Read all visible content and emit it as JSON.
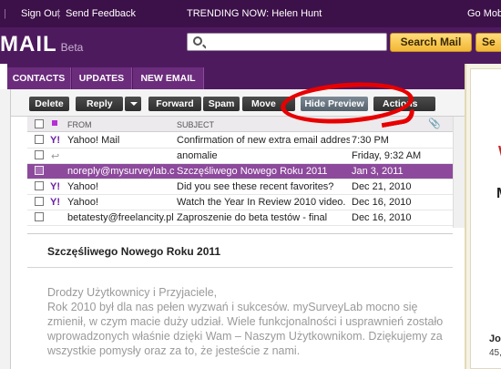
{
  "topbar": {
    "sign_out": "Sign Out",
    "send_feedback": "Send Feedback",
    "trending": "TRENDING NOW: Helen Hunt",
    "go_mobile": "Go Mobile"
  },
  "header": {
    "logo": "MAIL",
    "logo_badge": "Beta",
    "search_placeholder": "",
    "search_mail_button": "Search Mail",
    "search_web_button": "Se"
  },
  "tabs": [
    {
      "label": "CONTACTS"
    },
    {
      "label": "UPDATES"
    },
    {
      "label": "NEW EMAIL"
    }
  ],
  "toolbar": {
    "delete": "Delete",
    "reply": "Reply",
    "forward": "Forward",
    "spam": "Spam",
    "move": "Move",
    "hide_preview": "Hide Preview",
    "actions": "Actions"
  },
  "list": {
    "headers": {
      "from": "FROM",
      "subject": "SUBJECT"
    },
    "rows": [
      {
        "from": "Yahoo! Mail",
        "subject": "Confirmation of new extra email address",
        "date": "7:30 PM",
        "icon": "yahoo-icon",
        "selected": false
      },
      {
        "from": "",
        "subject": "anomalie",
        "date": "Friday, 9:32 AM",
        "icon": "reply-arrow-icon",
        "selected": false
      },
      {
        "from": "noreply@mysurveylab.co",
        "subject": "Szczęśliwego Nowego Roku 2011",
        "date": "Jan 3, 2011",
        "icon": "",
        "selected": true
      },
      {
        "from": "Yahoo!",
        "subject": "Did you see these recent favorites?",
        "date": "Dec 21, 2010",
        "icon": "yahoo-icon",
        "selected": false
      },
      {
        "from": "Yahoo!",
        "subject": "Watch the Year In Review 2010 video.",
        "date": "Dec 16, 2010",
        "icon": "yahoo-icon",
        "selected": false
      },
      {
        "from": "betatesty@freelancity.pl",
        "subject": "Zaproszenie do beta testów - final",
        "date": "Dec 16, 2010",
        "icon": "",
        "selected": false
      }
    ]
  },
  "preview": {
    "subject": "Szczęśliwego Nowego Roku 2011",
    "greeting": "Drodzy Użytkownicy i Przyjaciele,",
    "body": "Rok 2010 był dla nas pełen wyzwań i sukcesów. mySurveyLab mocno się zmienił, w czym macie duży udział. Wiele funkcjonalności i usprawnień zostało wprowadzonych właśnie dzięki Wam – Naszym Użytkownikom. Dziękujemy za wszystkie pomysły oraz za to, że jesteście z nami."
  },
  "right_panel": {
    "texts": [
      "W",
      "M",
      "Joh",
      "45,"
    ]
  },
  "colors": {
    "brand_purple": "#4e1a5e",
    "selected_row": "#8d4a9c",
    "annotation": "#e80000"
  }
}
